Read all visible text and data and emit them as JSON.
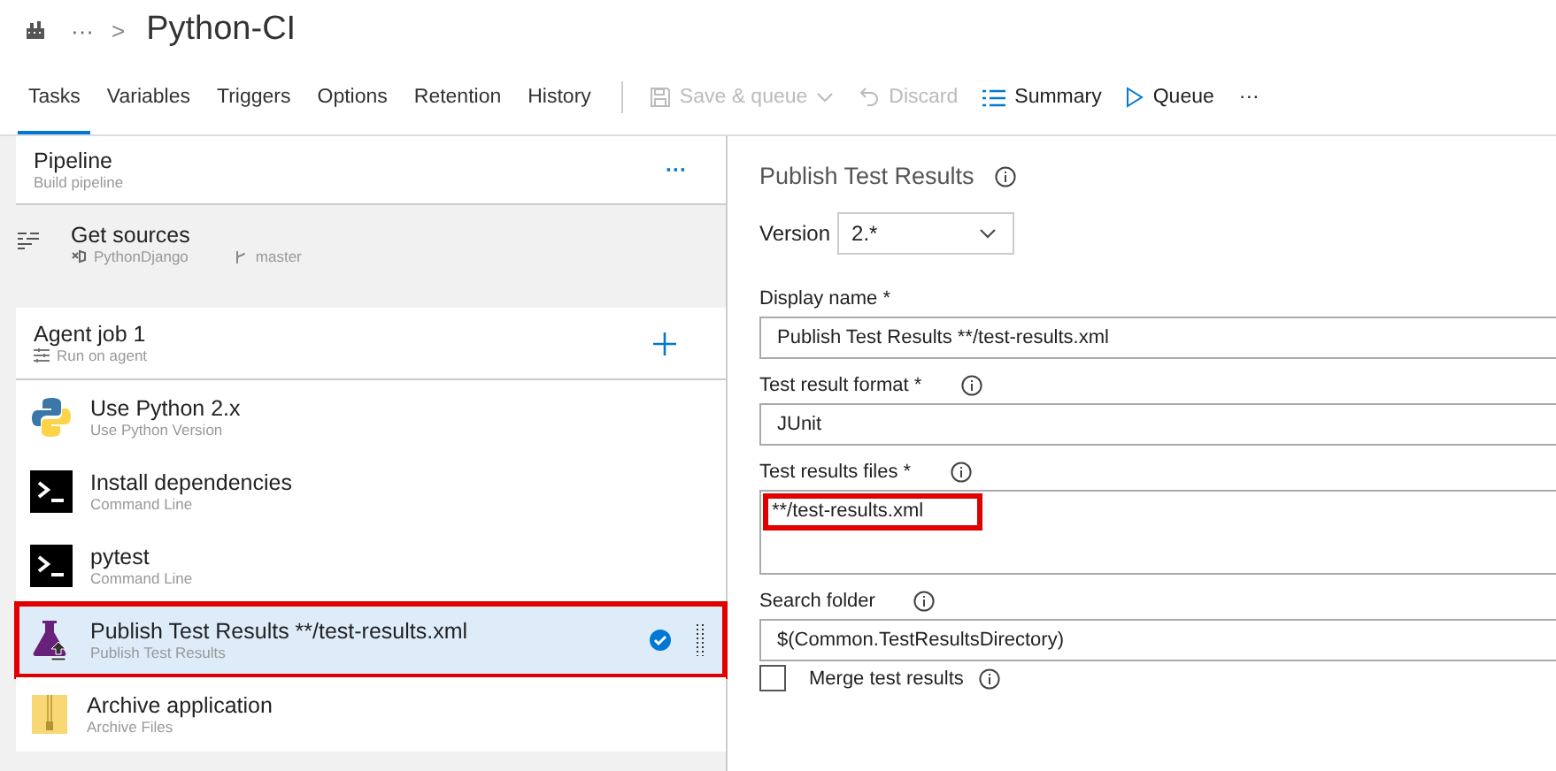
{
  "breadcrumb": {
    "ellipsis": "···",
    "separator": ">",
    "title": "Python-CI"
  },
  "tabs": [
    {
      "label": "Tasks",
      "selected": true
    },
    {
      "label": "Variables",
      "selected": false
    },
    {
      "label": "Triggers",
      "selected": false
    },
    {
      "label": "Options",
      "selected": false
    },
    {
      "label": "Retention",
      "selected": false
    },
    {
      "label": "History",
      "selected": false
    }
  ],
  "toolbar": [
    {
      "kind": "save",
      "label": "Save & queue",
      "disabled": true
    },
    {
      "kind": "discard",
      "label": "Discard",
      "disabled": true
    },
    {
      "kind": "summary",
      "label": "Summary",
      "disabled": false
    },
    {
      "kind": "queue",
      "label": "Queue",
      "disabled": false
    },
    {
      "kind": "more",
      "label": "···",
      "disabled": false
    }
  ],
  "pipeline": {
    "title": "Pipeline",
    "subtitle": "Build pipeline",
    "more": "···"
  },
  "get_sources": {
    "title": "Get sources",
    "repository": "PythonDjango",
    "branch": "master"
  },
  "agent_job": {
    "title": "Agent job 1",
    "subtitle": "Run on agent"
  },
  "tasks": [
    {
      "kind": "python",
      "title": "Use Python 2.x",
      "subtitle": "Use Python Version",
      "selected": false,
      "highlighted": false
    },
    {
      "kind": "command",
      "title": "Install dependencies",
      "subtitle": "Command Line",
      "selected": false,
      "highlighted": false
    },
    {
      "kind": "command",
      "title": "pytest",
      "subtitle": "Command Line",
      "selected": false,
      "highlighted": false
    },
    {
      "kind": "test",
      "title": "Publish Test Results **/test-results.xml",
      "subtitle": "Publish Test Results",
      "selected": true,
      "highlighted": true
    },
    {
      "kind": "archive",
      "title": "Archive application",
      "subtitle": "Archive Files",
      "selected": false,
      "highlighted": false
    }
  ],
  "details": {
    "title": "Publish Test Results",
    "version": {
      "label": "Version",
      "value": "2.*"
    },
    "fields": [
      {
        "kind": "text",
        "label": "Display name *",
        "info": false,
        "value": "Publish Test Results **/test-results.xml",
        "highlighted": false
      },
      {
        "kind": "text",
        "label": "Test result format *",
        "info": true,
        "value": "JUnit",
        "highlighted": false
      },
      {
        "kind": "textarea",
        "label": "Test results files *",
        "info": true,
        "value": "**/test-results.xml",
        "highlighted": true
      },
      {
        "kind": "text",
        "label": "Search folder",
        "info": true,
        "value": "$(Common.TestResultsDirectory)",
        "highlighted": false
      },
      {
        "kind": "checkbox",
        "label": "Merge test results",
        "info": true,
        "checked": false
      }
    ]
  }
}
